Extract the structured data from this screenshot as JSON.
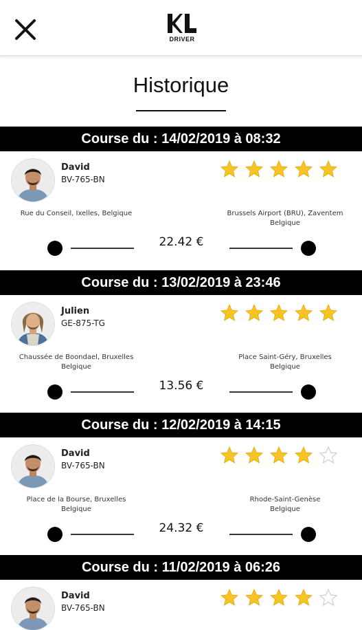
{
  "header": {
    "close_icon": "close-icon",
    "logo_text": "KL",
    "logo_subtitle": "DRIVER"
  },
  "page": {
    "title": "Historique"
  },
  "colors": {
    "star_filled": "#F7C325",
    "star_empty_outline": "#cfcfcf",
    "header_bg": "#000000"
  },
  "trips": [
    {
      "header": "Course du : 14/02/2019 à 08:32",
      "driver": {
        "name": "David",
        "plate": "BV-765-BN"
      },
      "rating": 5,
      "from": "Rue du Conseil, Ixelles, Belgique",
      "to_line1": "Brussels Airport (BRU), Zaventem",
      "to_line2": "Belgique",
      "price": "22.42 €"
    },
    {
      "header": "Course du : 13/02/2019 à 23:46",
      "driver": {
        "name": "Julien",
        "plate": "GE-875-TG"
      },
      "rating": 5,
      "from_line1": "Chaussée de Boondael, Bruxelles",
      "from_line2": "Belgique",
      "to_line1": "Place Saint-Géry, Bruxelles",
      "to_line2": "Belgique",
      "price": "13.56 €"
    },
    {
      "header": "Course du : 12/02/2019 à 14:15",
      "driver": {
        "name": "David",
        "plate": "BV-765-BN"
      },
      "rating": 4,
      "from_line1": "Place de la Bourse, Bruxelles",
      "from_line2": "Belgique",
      "to_line1": "Rhode-Saint-Genèse",
      "to_line2": "Belgique",
      "price": "24.32 €"
    },
    {
      "header": "Course du : 11/02/2019 à 06:26",
      "driver": {
        "name": "David",
        "plate": "BV-765-BN"
      },
      "rating": 4
    }
  ]
}
